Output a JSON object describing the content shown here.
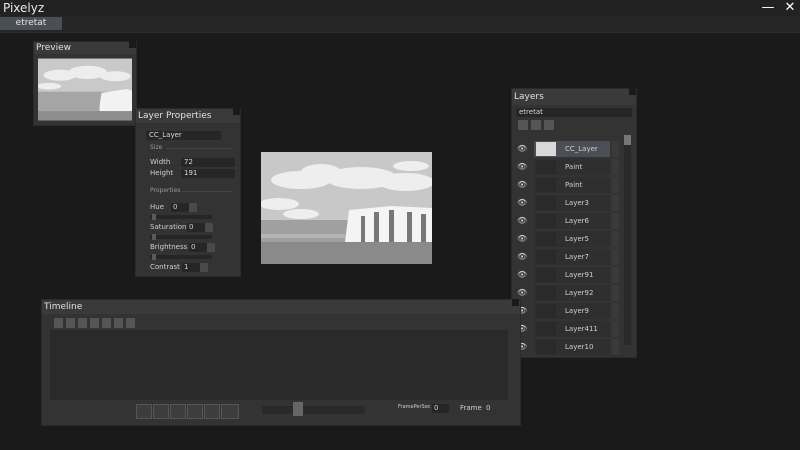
{
  "app": {
    "title": "Pixelyz",
    "minimize_glyph": "—",
    "close_glyph": "✕"
  },
  "tabs": [
    {
      "label": "etretat",
      "active": true
    }
  ],
  "preview": {
    "title": "Preview"
  },
  "layer_properties": {
    "title": "Layer Properties",
    "name": "CC_Layer",
    "size_section": "Size",
    "width_label": "Width",
    "width_value": "72",
    "height_label": "Height",
    "height_value": "191",
    "properties_section": "Properties",
    "hue_label": "Hue",
    "hue_value": "0",
    "saturation_label": "Saturation",
    "saturation_value": "0",
    "brightness_label": "Brightness",
    "brightness_value": "0",
    "contrast_label": "Contrast",
    "contrast_value": "1"
  },
  "layers": {
    "title": "Layers",
    "document": "etretat",
    "items": [
      {
        "name": "CC_Layer",
        "selected": true
      },
      {
        "name": "Paint"
      },
      {
        "name": "Paint"
      },
      {
        "name": "Layer3"
      },
      {
        "name": "Layer6"
      },
      {
        "name": "Layer5"
      },
      {
        "name": "Layer7"
      },
      {
        "name": "Layer91"
      },
      {
        "name": "Layer92"
      },
      {
        "name": "Layer9"
      },
      {
        "name": "Layer411"
      },
      {
        "name": "Layer10"
      }
    ]
  },
  "timeline": {
    "title": "Timeline",
    "frames_per_sec_label": "FramePerSec",
    "frames_per_sec_value": "0",
    "frame_label": "Frame",
    "frame_value": "0"
  },
  "colors": {
    "background": "#1a1a1a",
    "panel": "#333333",
    "accent": "#4a4f55"
  },
  "icons": [
    "eye-icon",
    "minimize-icon",
    "close-icon",
    "play-icon",
    "loop-icon"
  ]
}
